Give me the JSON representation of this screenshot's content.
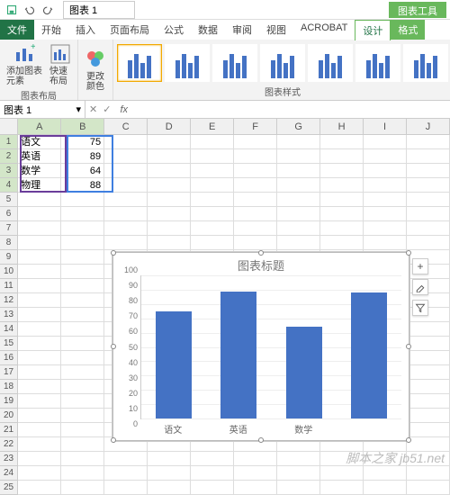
{
  "titlebar": {
    "title": "图表 1",
    "chart_tools": "图表工具"
  },
  "tabs": {
    "file": "文件",
    "home": "开始",
    "insert": "插入",
    "layout": "页面布局",
    "formulas": "公式",
    "data": "数据",
    "review": "审阅",
    "view": "视图",
    "acrobat": "ACROBAT",
    "design": "设计",
    "format": "格式"
  },
  "ribbon": {
    "add_element": "添加图表\n元素",
    "quick_layout": "快速布局",
    "change_colors": "更改\n颜色",
    "group_layout": "图表布局",
    "group_styles": "图表样式"
  },
  "namebox": "图表 1",
  "fx": "fx",
  "columns": [
    "A",
    "B",
    "C",
    "D",
    "E",
    "F",
    "G",
    "H",
    "I",
    "J"
  ],
  "sheet": {
    "a": [
      "语文",
      "英语",
      "数学",
      "物理"
    ],
    "b": [
      "75",
      "89",
      "64",
      "88"
    ]
  },
  "chart": {
    "title": "图表标题",
    "yticks": [
      "0",
      "10",
      "20",
      "30",
      "40",
      "50",
      "60",
      "70",
      "80",
      "90",
      "100"
    ],
    "xlabels": [
      "语文",
      "英语",
      "数学"
    ]
  },
  "side": {
    "plus": "+",
    "brush": "",
    "filter": ""
  },
  "watermark": "脚本之家 jb51.net",
  "chart_data": {
    "type": "bar",
    "title": "图表标题",
    "categories": [
      "语文",
      "英语",
      "数学",
      "物理"
    ],
    "values": [
      75,
      89,
      64,
      88
    ],
    "xlabel": "",
    "ylabel": "",
    "ylim": [
      0,
      100
    ]
  }
}
